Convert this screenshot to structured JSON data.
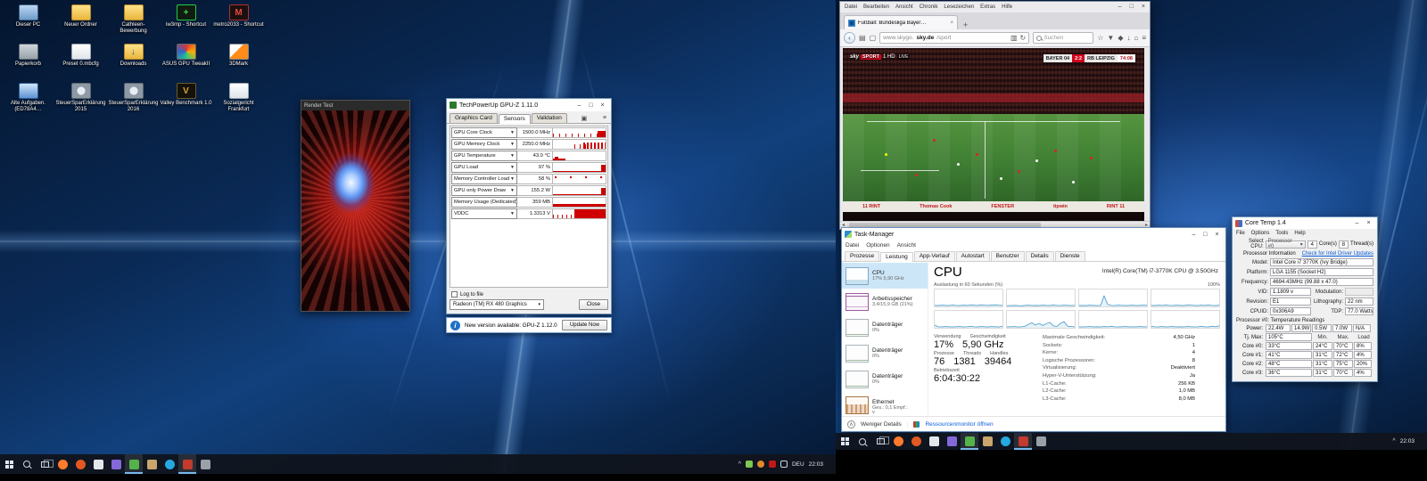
{
  "desktop": {
    "icons": [
      {
        "label": "Dieser PC",
        "type": "pc",
        "glyph": ""
      },
      {
        "label": "Neuer Ordner",
        "type": "folder",
        "glyph": ""
      },
      {
        "label": "Cathleen- Bewerbung",
        "type": "folder",
        "glyph": ""
      },
      {
        "label": "iw3mp - Shortcut",
        "type": "game-green",
        "glyph": "+"
      },
      {
        "label": "metro2033 - Shortcut",
        "type": "game-red",
        "glyph": "M"
      },
      {
        "label": "Papierkorb",
        "type": "bin",
        "glyph": ""
      },
      {
        "label": "Preset 0.mbcfg",
        "type": "doc",
        "glyph": ""
      },
      {
        "label": "Downloads",
        "type": "folder-dl",
        "glyph": "↓"
      },
      {
        "label": "ASUS GPU TweakII",
        "type": "tweak",
        "glyph": ""
      },
      {
        "label": "3DMark",
        "type": "3dmark",
        "glyph": ""
      },
      {
        "label": "Alte Aufgaben.(ED78A4…",
        "type": "tasks",
        "glyph": ""
      },
      {
        "label": "SteuerSparErklärung 2015",
        "type": "wheel",
        "glyph": ""
      },
      {
        "label": "SteuerSparErklärung 2016",
        "type": "wheel",
        "glyph": ""
      },
      {
        "label": "Valley Benchmark 1.0",
        "type": "valley",
        "glyph": "V"
      },
      {
        "label": "Sozialgericht Frankfurt",
        "type": "doc",
        "glyph": ""
      }
    ]
  },
  "render_test": {
    "title": "Render Test"
  },
  "gpuz": {
    "title": "TechPowerUp GPU-Z 1.11.0",
    "tabs": [
      "Graphics Card",
      "Sensors",
      "Validation"
    ],
    "active_tab": "Sensors",
    "sensors": [
      {
        "label": "GPU Core Clock",
        "value": "1500.0 MHz",
        "graph": "g-ticks"
      },
      {
        "label": "GPU Memory Clock",
        "value": "2250.0 MHz",
        "graph": "g-bars"
      },
      {
        "label": "GPU Temperature",
        "value": "43.0 °C",
        "graph": "g-flat"
      },
      {
        "label": "GPU Load",
        "value": "97 %",
        "graph": "g-spike"
      },
      {
        "label": "Memory Controller Load",
        "value": "58 %",
        "graph": "g-dots"
      },
      {
        "label": "GPU only Power Draw",
        "value": "155.2 W",
        "graph": "g-spike"
      },
      {
        "label": "Memory Usage (Dedicated)",
        "value": "359 MB",
        "graph": "g-low"
      },
      {
        "label": "VDDC",
        "value": "1.3313 V",
        "graph": "g-fill"
      }
    ],
    "log_to_file": "Log to file",
    "device": "Radeon (TM) RX 480 Graphics",
    "close_label": "Close",
    "update_text": "New version available: GPU-Z 1.12.0",
    "update_button": "Update Now"
  },
  "browser": {
    "menu": [
      "Datei",
      "Bearbeiten",
      "Ansicht",
      "Chronik",
      "Lesezeichen",
      "Extras",
      "Hilfe"
    ],
    "tab_title": "Fußball: Bundesliga Bayer…",
    "url": {
      "prefix": "www.skygo.",
      "domain": "sky.de",
      "path": "/sport"
    },
    "search_placeholder": "Suchen",
    "video": {
      "badge": {
        "brand": "sky",
        "sport": "SPORT",
        "channel": "1 HD",
        "live": "LIVE"
      },
      "score": {
        "home": "BAYER 04",
        "result": "2:2",
        "away": "RB LEIPZIG",
        "clock": "74:08"
      },
      "ads": [
        "11 RINT",
        "Thomas Cook",
        "FENSTER",
        "tipwin",
        "RINT 11"
      ]
    }
  },
  "taskmgr": {
    "title": "Task-Manager",
    "menu": [
      "Datei",
      "Optionen",
      "Ansicht"
    ],
    "tabs": [
      "Prozesse",
      "Leistung",
      "App-Verlauf",
      "Autostart",
      "Benutzer",
      "Details",
      "Dienste"
    ],
    "active_tab": "Leistung",
    "sidebar": [
      {
        "name": "CPU",
        "sub": "17% 5,90 GHz",
        "kind": "cpu",
        "selected": true
      },
      {
        "name": "Arbeitsspeicher",
        "sub": "3,4/15,9 GB (21%)",
        "kind": "mem",
        "selected": false
      },
      {
        "name": "Datenträger",
        "sub": "0%",
        "kind": "disk",
        "selected": false
      },
      {
        "name": "Datenträger",
        "sub": "0%",
        "kind": "disk",
        "selected": false
      },
      {
        "name": "Datenträger",
        "sub": "0%",
        "kind": "disk",
        "selected": false
      },
      {
        "name": "Ethernet",
        "sub": "Ges.: 0,1 Empf.:",
        "kind": "eth",
        "selected": false
      }
    ],
    "cpu": {
      "heading": "CPU",
      "model": "Intel(R) Core(TM) i7-3770K CPU @ 3.50GHz",
      "graph_label": "Auslastung in 60 Sekunden (%)",
      "graph_max": "100%",
      "graphs": [
        [
          6,
          5,
          7,
          6,
          5,
          8,
          6,
          5,
          7,
          6,
          8,
          7,
          6,
          9,
          7,
          6,
          8,
          10,
          7,
          6
        ],
        [
          4,
          5,
          6,
          5,
          4,
          6,
          7,
          5,
          6,
          5,
          7,
          6,
          5,
          8,
          6,
          5,
          7,
          6,
          5,
          6
        ],
        [
          5,
          6,
          5,
          7,
          6,
          5,
          6,
          62,
          12,
          6,
          5,
          7,
          6,
          5,
          6,
          7,
          5,
          6,
          7,
          6
        ],
        [
          6,
          5,
          7,
          6,
          8,
          6,
          5,
          7,
          6,
          5,
          8,
          7,
          6,
          5,
          7,
          6,
          8,
          6,
          5,
          7
        ],
        [
          16,
          6,
          5,
          7,
          6,
          5,
          6,
          7,
          5,
          6,
          8,
          6,
          5,
          7,
          6,
          5,
          7,
          6,
          5,
          8
        ],
        [
          5,
          6,
          7,
          5,
          6,
          8,
          20,
          30,
          16,
          26,
          14,
          24,
          32,
          12,
          8,
          26,
          36,
          10,
          7,
          6
        ],
        [
          6,
          5,
          6,
          7,
          5,
          6,
          5,
          7,
          6,
          8,
          6,
          5,
          6,
          7,
          5,
          6,
          5,
          7,
          6,
          5
        ],
        [
          8,
          6,
          5,
          7,
          5,
          6,
          7,
          5,
          6,
          5,
          7,
          6,
          5,
          6,
          8,
          6,
          5,
          9,
          6,
          12
        ]
      ],
      "stats": {
        "usage_label": "Verwendung",
        "usage": "17%",
        "speed_label": "Geschwindigkeit",
        "speed": "5,90 GHz",
        "proc_label": "Prozesse",
        "proc": "76",
        "threads_label": "Threads",
        "threads": "1381",
        "handles_label": "Handles",
        "handles": "39464",
        "uptime_label": "Betriebszeit",
        "uptime": "6:04:30:22"
      },
      "details": [
        [
          "Maximale Geschwindigkeit:",
          "4,50 GHz"
        ],
        [
          "Sockets:",
          "1"
        ],
        [
          "Kerne:",
          "4"
        ],
        [
          "Logische Prozessoren:",
          "8"
        ],
        [
          "Virtualisierung:",
          "Deaktiviert"
        ],
        [
          "Hyper-V-Unterstützung:",
          "Ja"
        ],
        [
          "L1-Cache:",
          "256 KB"
        ],
        [
          "L2-Cache:",
          "1,0 MB"
        ],
        [
          "L3-Cache:",
          "8,0 MB"
        ]
      ]
    },
    "footer": {
      "less": "Weniger Details",
      "resmon": "Ressourcenmonitor öffnen"
    }
  },
  "coretemp": {
    "title": "Core Temp 1.4",
    "menu": [
      "File",
      "Options",
      "Tools",
      "Help"
    ],
    "select_label": "Select CPU:",
    "processor": "Processor #0",
    "cores_box": "4",
    "cores_label": "Core(s)",
    "threads_box": "8",
    "threads_label": "Thread(s)",
    "info_label": "Processor Information",
    "driver_link": "Check for Intel Driver Updates",
    "fields": [
      {
        "label": "Model:",
        "value": "Intel Core i7 3770K (Ivy Bridge)"
      },
      {
        "label": "Platform:",
        "value": "LGA 1155 (Socket H2)"
      },
      {
        "label": "Frequency:",
        "value": "4694.43MHz (99.88 x 47.0)"
      }
    ],
    "field_pairs": [
      [
        {
          "label": "VID:",
          "value": "1.1809 v"
        },
        {
          "label": "Modulation:",
          "value": "",
          "disabled": true
        }
      ],
      [
        {
          "label": "Revision:",
          "value": "E1"
        },
        {
          "label": "Lithography:",
          "value": "22 nm"
        }
      ],
      [
        {
          "label": "CPUID:",
          "value": "0x306A9"
        },
        {
          "label": "TDP:",
          "value": "77.0 Watts"
        }
      ]
    ],
    "readings_title": "Processor #0: Temperature Readings",
    "power_label": "Power:",
    "power_cells": [
      "22.4W",
      "14.9W",
      "0.5W",
      "7.0W",
      "N/A"
    ],
    "tjmax_label": "Tj. Max:",
    "tjmax": "105°C",
    "col_headers": [
      "Min.",
      "Max.",
      "Load"
    ],
    "cores_table": [
      {
        "label": "Core #0:",
        "cur": "33°C",
        "min": "24°C",
        "max": "70°C",
        "load": "8%"
      },
      {
        "label": "Core #1:",
        "cur": "41°C",
        "min": "31°C",
        "max": "72°C",
        "load": "4%"
      },
      {
        "label": "Core #2:",
        "cur": "48°C",
        "min": "31°C",
        "max": "75°C",
        "load": "20%"
      },
      {
        "label": "Core #3:",
        "cur": "36°C",
        "min": "31°C",
        "max": "70°C",
        "load": "4%"
      }
    ]
  },
  "taskbar": {
    "apps": [
      {
        "app": "firefox",
        "color": "#ff7a2d",
        "shape": "circle",
        "open": false
      },
      {
        "app": "browser-orange",
        "color": "#e25822",
        "shape": "circle",
        "open": false
      },
      {
        "app": "tool-light",
        "color": "#e3e6ea",
        "shape": "square",
        "open": false
      },
      {
        "app": "tool-purple",
        "color": "#8468d9",
        "shape": "square",
        "open": false
      },
      {
        "app": "gpu-tool",
        "color": "#55b24a",
        "shape": "square",
        "open": true
      },
      {
        "app": "notes",
        "color": "#c9a66b",
        "shape": "square",
        "open": false
      },
      {
        "app": "skype",
        "color": "#26a8e0",
        "shape": "circle",
        "open": false
      },
      {
        "app": "recorder",
        "color": "#c23b2e",
        "shape": "square",
        "open": true
      },
      {
        "app": "game-controller",
        "color": "#9aa0a8",
        "shape": "square",
        "open": false
      }
    ],
    "tray_left": {
      "lang": "DEU",
      "time": "22:03"
    },
    "tray_right": {
      "time": "22:03"
    }
  },
  "colors": {
    "accent": "#76b9ed",
    "red": "#d0021b",
    "tm_blue": "#3a93c8"
  }
}
